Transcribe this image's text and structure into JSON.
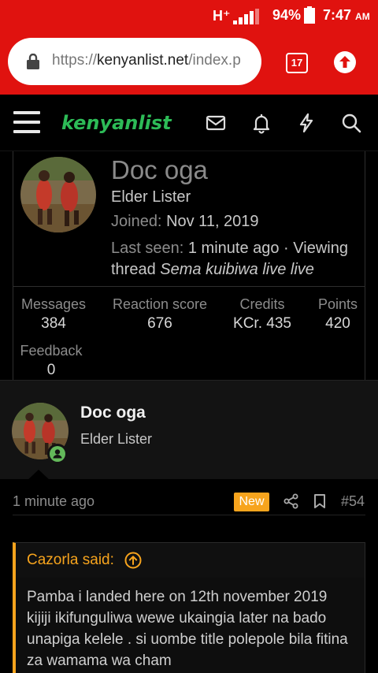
{
  "status_bar": {
    "network": "H⁺",
    "battery": "94%",
    "time": "7:47",
    "ampm": "AM"
  },
  "browser": {
    "url_scheme": "https://",
    "url_host": "kenyanlist.net",
    "url_path": "/index.p",
    "tab_count": "17"
  },
  "site": {
    "logo_text": "kenyanlist"
  },
  "member": {
    "username": "Doc oga",
    "user_title": "Elder Lister",
    "joined_label": "Joined:",
    "joined_value": "Nov 11, 2019",
    "last_seen_label": "Last seen:",
    "last_seen_value": "1 minute ago · Viewing thread",
    "last_seen_thread": "Sema kuibiwa live live",
    "stats": [
      {
        "label": "Messages",
        "value": "384"
      },
      {
        "label": "Reaction score",
        "value": "676"
      },
      {
        "label": "Credits",
        "value": "KCr. 435"
      },
      {
        "label": "Points",
        "value": "420"
      },
      {
        "label": "Feedback",
        "value": "0"
      }
    ]
  },
  "post": {
    "author": "Doc oga",
    "author_title": "Elder Lister",
    "time": "1 minute ago",
    "new_badge": "New",
    "post_number": "#54",
    "quote_author": "Cazorla said:",
    "quote_text": "Pamba i landed here on 12th november 2019 kijiji ikifunguliwa wewe ukaingia later na bado unapiga kelele . si uombe title polepole bila fitina za wamama wa cham"
  },
  "colors": {
    "chrome_red": "#e0120f",
    "logo_green": "#2dbb57",
    "accent_orange": "#f7a41d",
    "online_green": "#63b95a"
  },
  "icons": [
    "lock-icon",
    "tabs-icon",
    "update-icon",
    "menu-icon",
    "mail-icon",
    "bell-icon",
    "bolt-icon",
    "search-icon",
    "share-icon",
    "bookmark-icon",
    "arrow-up-icon"
  ]
}
